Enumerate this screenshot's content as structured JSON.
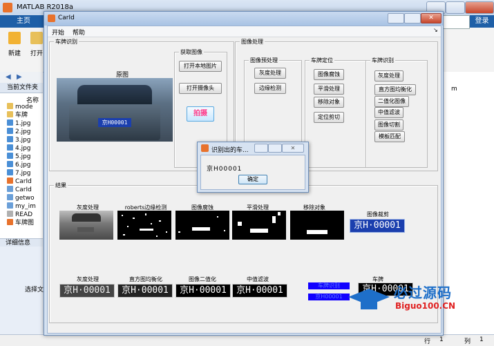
{
  "matlab": {
    "title": "MATLAB R2018a",
    "tab_home": "主页",
    "login": "登录",
    "ribbon": {
      "new_label": "新建",
      "open_label": "打开"
    },
    "current_folder": "当前文件夹",
    "name_header": "名称",
    "files": [
      {
        "name": "mode",
        "type": "folder"
      },
      {
        "name": "车牌",
        "type": "folder"
      },
      {
        "name": "1.jpg",
        "type": "jpg"
      },
      {
        "name": "2.jpg",
        "type": "jpg"
      },
      {
        "name": "3.jpg",
        "type": "jpg"
      },
      {
        "name": "4.jpg",
        "type": "jpg"
      },
      {
        "name": "5.jpg",
        "type": "jpg"
      },
      {
        "name": "6.jpg",
        "type": "jpg"
      },
      {
        "name": "7.jpg",
        "type": "jpg"
      },
      {
        "name": "CarId",
        "type": "fig"
      },
      {
        "name": "CarId",
        "type": "m"
      },
      {
        "name": "getwo",
        "type": "m"
      },
      {
        "name": "my_im",
        "type": "m"
      },
      {
        "name": "READ",
        "type": "txt"
      },
      {
        "name": "车牌图",
        "type": "fig"
      }
    ],
    "details_header": "详细信息",
    "select_file_hint": "选择文",
    "right_header": "m",
    "status": {
      "row_label": "行",
      "row_value": "1",
      "col_label": "列",
      "col_value": "1"
    }
  },
  "carid": {
    "title": "CarId",
    "menu": [
      "开始",
      "帮助"
    ],
    "panel_recog": "车牌识别",
    "original_caption": "原图",
    "acquire_panel": "获取图像",
    "btn_open_local": "打开本地图片",
    "btn_open_camera": "打开摄像头",
    "btn_capture": "拍摄",
    "processing_panel": "图像处理",
    "preproc_panel": "图像预处理",
    "btn_gray": "灰度处理",
    "btn_edge": "边缘检测",
    "locate_panel": "车牌定位",
    "btn_erode": "图像腐蚀",
    "btn_smooth": "平滑处理",
    "btn_remove": "移除对象",
    "btn_crop": "定位剪切",
    "recog_panel": "车牌识别",
    "btn_gray2": "灰度处理",
    "btn_hist": "直方图均衡化",
    "btn_binary": "二值化图像",
    "btn_median": "中值滤波",
    "btn_cut": "图像切割",
    "btn_match": "模板匹配",
    "result_panel": "结果",
    "captions_row1": [
      "灰度处理",
      "roberts边缘检测",
      "图像腐蚀",
      "平滑处理",
      "移除对象",
      "图像裁剪"
    ],
    "captions_row2": [
      "灰度处理",
      "直方图均衡化",
      "图像二值化",
      "中值滤波",
      "车牌"
    ],
    "plate_text": "京H·00001",
    "plate_text_small": "京H00001",
    "result_blue_1": "车牌识别",
    "result_blue_2": "京H00001"
  },
  "popup": {
    "title": "识别出的车...",
    "message": "京H00001",
    "ok": "确定"
  },
  "watermark": {
    "main": "必过源码",
    "sub": "Biguo100.CN"
  },
  "colors": {
    "accent": "#1e5fa7",
    "plate_blue": "#1b3fae",
    "capture_pink": "#ff3b8a",
    "blue_box": "#1200ff"
  }
}
